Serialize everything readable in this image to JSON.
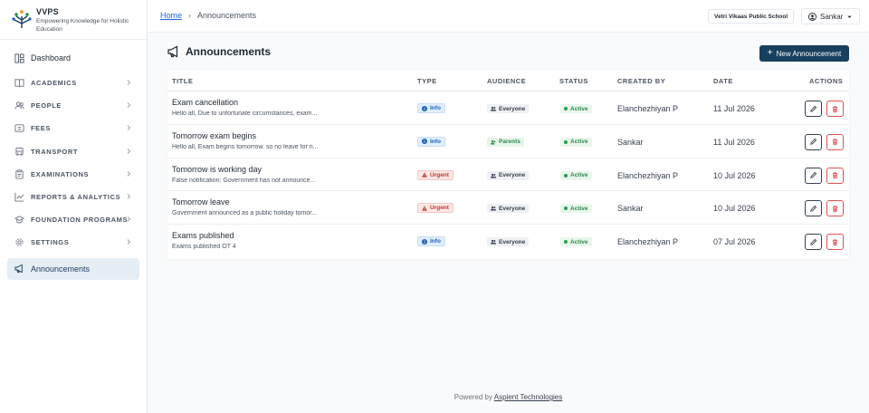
{
  "brand": {
    "name": "VVPS",
    "tagline": "Empowering Knowledge for Holistic Education"
  },
  "sidebar": {
    "dashboard": "Dashboard",
    "items": [
      {
        "label": "ACADEMICS",
        "icon": "book-icon"
      },
      {
        "label": "PEOPLE",
        "icon": "people-icon"
      },
      {
        "label": "FEES",
        "icon": "fees-icon"
      },
      {
        "label": "TRANSPORT",
        "icon": "bus-icon"
      },
      {
        "label": "EXAMINATIONS",
        "icon": "clipboard-icon"
      },
      {
        "label": "REPORTS & ANALYTICS",
        "icon": "chart-line-icon"
      },
      {
        "label": "FOUNDATION PROGRAMS",
        "icon": "graduation-cap-icon"
      },
      {
        "label": "SETTINGS",
        "icon": "gear-icon"
      }
    ],
    "active": "Announcements"
  },
  "topbar": {
    "breadcrumb_home": "Home",
    "breadcrumb_sep": "›",
    "breadcrumb_current": "Announcements",
    "school": "Vetri Vikaas Public School",
    "user": "Sankar"
  },
  "page": {
    "title": "Announcements",
    "new_button": "New Announcement",
    "plus": "+"
  },
  "table": {
    "headers": {
      "title": "TITLE",
      "type": "TYPE",
      "audience": "AUDIENCE",
      "status": "STATUS",
      "created_by": "CREATED BY",
      "date": "DATE",
      "actions": "ACTIONS"
    },
    "rows": [
      {
        "title": "Exam cancellation",
        "sub": "Hello all, Due to unfortunate circumstances, exam...",
        "type": "Info",
        "audience": "Everyone",
        "status": "Active",
        "created_by": "Elanchezhiyan P",
        "date": "11 Jul 2026"
      },
      {
        "title": "Tomorrow exam begins",
        "sub": "Hello all, Exam begins tomorrow. so no leave for n...",
        "type": "Info",
        "audience": "Parents",
        "status": "Active",
        "created_by": "Sankar",
        "date": "11 Jul 2026"
      },
      {
        "title": "Tomorrow is working day",
        "sub": "False notification: Government has not announce...",
        "type": "Urgent",
        "audience": "Everyone",
        "status": "Active",
        "created_by": "Elanchezhiyan P",
        "date": "10 Jul 2026"
      },
      {
        "title": "Tomorrow leave",
        "sub": "Government announced as a public holiday tomor...",
        "type": "Urgent",
        "audience": "Everyone",
        "status": "Active",
        "created_by": "Sankar",
        "date": "10 Jul 2026"
      },
      {
        "title": "Exams published",
        "sub": "Exams published OT 4",
        "type": "Info",
        "audience": "Everyone",
        "status": "Active",
        "created_by": "Elanchezhiyan P",
        "date": "07 Jul 2026"
      }
    ]
  },
  "footer": {
    "prefix": "Powered by",
    "link": "Aspient Technologies"
  },
  "colors": {
    "primary": "#17405e",
    "info": "#1d5fb8",
    "urgent": "#c0392b",
    "active": "#22a04b",
    "delete": "#e05252"
  }
}
